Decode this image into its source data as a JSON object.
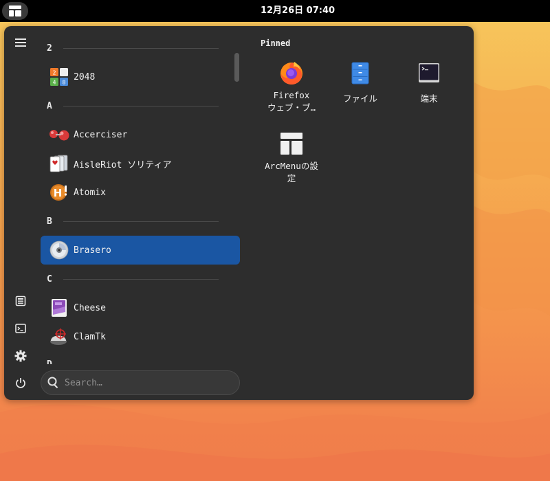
{
  "topbar": {
    "clock": "12月26日 07:40"
  },
  "sidebar": {
    "menu_icon": "hamburger-icon",
    "buttons": [
      "documents-icon",
      "terminal-icon",
      "settings-icon",
      "power-icon"
    ]
  },
  "applist": {
    "categories": [
      "2",
      "A",
      "B",
      "C",
      "D"
    ],
    "apps": [
      {
        "label": "2048",
        "icon": "2048-icon"
      },
      {
        "label": "Accerciser",
        "icon": "accerciser-icon"
      },
      {
        "label": "AisleRiot ソリティア",
        "icon": "cards-icon"
      },
      {
        "label": "Atomix",
        "icon": "atomix-icon"
      },
      {
        "label": "Brasero",
        "icon": "disc-icon"
      },
      {
        "label": "Cheese",
        "icon": "cheese-icon"
      },
      {
        "label": "ClamTk",
        "icon": "clamtk-icon"
      }
    ],
    "selected": "Brasero"
  },
  "search": {
    "placeholder": "Search…"
  },
  "pinned": {
    "title": "Pinned",
    "items": [
      {
        "line1": "Firefox",
        "line2": "ウェブ・ブ…",
        "icon": "firefox-icon"
      },
      {
        "line1": "ファイル",
        "icon": "files-icon"
      },
      {
        "line1": "端末",
        "icon": "terminal-icon"
      },
      {
        "line1": "ArcMenuの設",
        "line2": "定",
        "icon": "arcmenu-icon"
      }
    ]
  },
  "colors": {
    "menu_bg": "#2d2d2d",
    "selected_bg": "#1a56a3",
    "wallpaper_top": "#f7c75a",
    "wallpaper_bottom": "#f07a4a"
  }
}
